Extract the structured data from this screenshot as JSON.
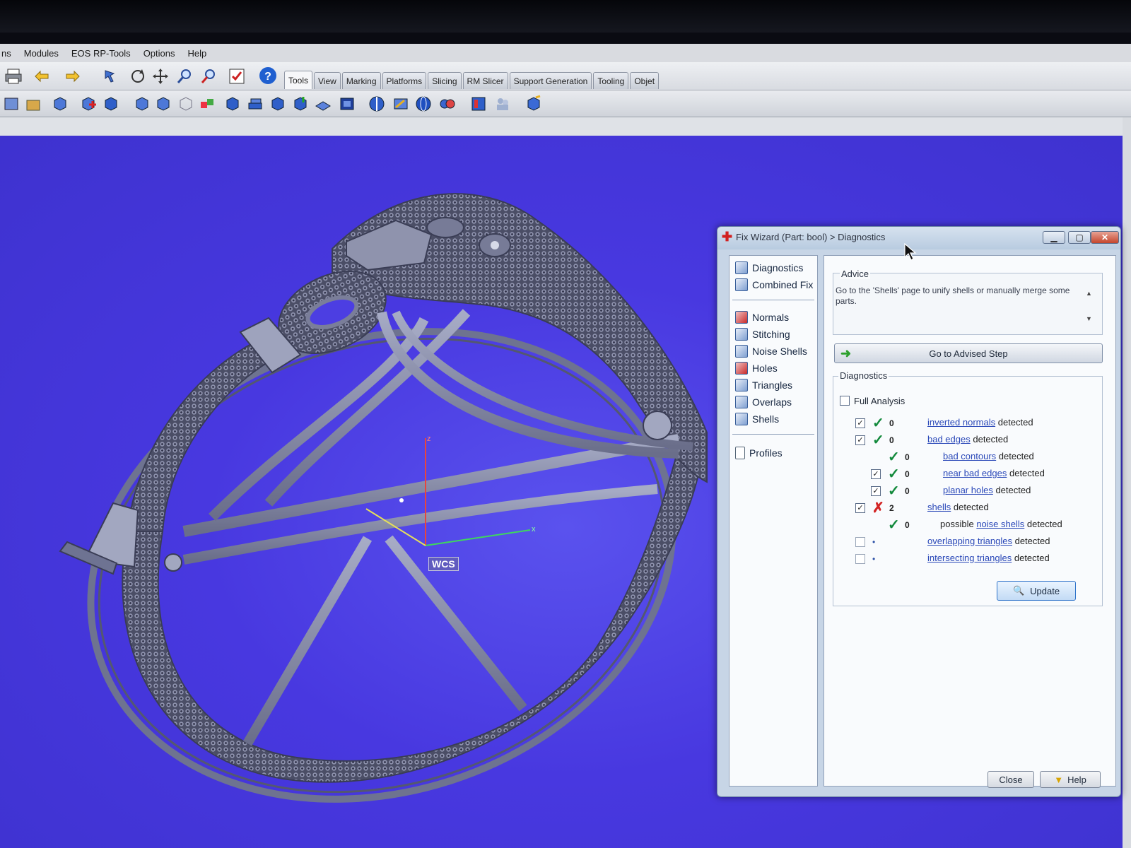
{
  "menu": {
    "items": [
      "ns",
      "Modules",
      "EOS RP-Tools",
      "Options",
      "Help"
    ]
  },
  "tabs": [
    "Tools",
    "View",
    "Marking",
    "Platforms",
    "Slicing",
    "RM Slicer",
    "Support Generation",
    "Tooling",
    "Objet"
  ],
  "viewport": {
    "wcs_label": "WCS",
    "axis_z": "z",
    "axis_x": "x",
    "background_color": "#4838e0"
  },
  "dialog": {
    "title": "Fix Wizard (Part: bool) > Diagnostics",
    "nav": {
      "diagnostics": "Diagnostics",
      "combined_fix": "Combined Fix",
      "normals": "Normals",
      "stitching": "Stitching",
      "noise_shells": "Noise Shells",
      "holes": "Holes",
      "triangles": "Triangles",
      "overlaps": "Overlaps",
      "shells": "Shells",
      "profiles": "Profiles"
    },
    "advice": {
      "label": "Advice",
      "text": "Go to the 'Shells' page to unify shells or manually merge some parts."
    },
    "goto_button": "Go to Advised Step",
    "diagnostics": {
      "label": "Diagnostics",
      "full_analysis": "Full Analysis",
      "suffix": "detected",
      "rows": [
        {
          "checked": true,
          "status": "ok",
          "count": "0",
          "prefix": "",
          "link": "inverted normals"
        },
        {
          "checked": true,
          "status": "ok",
          "count": "0",
          "prefix": "",
          "link": "bad edges"
        },
        {
          "checked": null,
          "status": "ok",
          "count": "0",
          "prefix": "",
          "link": "bad contours"
        },
        {
          "checked": true,
          "status": "ok",
          "count": "0",
          "prefix": "",
          "link": "near bad edges"
        },
        {
          "checked": true,
          "status": "ok",
          "count": "0",
          "prefix": "",
          "link": "planar holes"
        },
        {
          "checked": true,
          "status": "error",
          "count": "2",
          "prefix": "",
          "link": "shells"
        },
        {
          "checked": null,
          "status": "ok",
          "count": "0",
          "prefix": "possible",
          "link": "noise shells"
        },
        {
          "checked": false,
          "status": "dot",
          "count": "",
          "prefix": "",
          "link": "overlapping triangles"
        },
        {
          "checked": false,
          "status": "dot",
          "count": "",
          "prefix": "",
          "link": "intersecting triangles"
        }
      ]
    },
    "update_button": "Update",
    "close_button": "Close",
    "help_button": "Help"
  }
}
